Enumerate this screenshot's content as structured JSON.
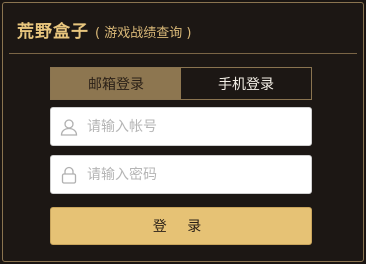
{
  "header": {
    "title": "荒野盒子",
    "subtitle": "( 游戏战绩查询 )"
  },
  "tabs": [
    {
      "label": "邮箱登录",
      "state": "inactive"
    },
    {
      "label": "手机登录",
      "state": "active"
    }
  ],
  "form": {
    "account_placeholder": "请输入帐号",
    "account_value": "",
    "password_placeholder": "请输入密码",
    "password_value": "",
    "login_label": "登 录"
  },
  "colors": {
    "accent": "#e6c275",
    "border": "#8a7450",
    "background": "#1c1714"
  }
}
